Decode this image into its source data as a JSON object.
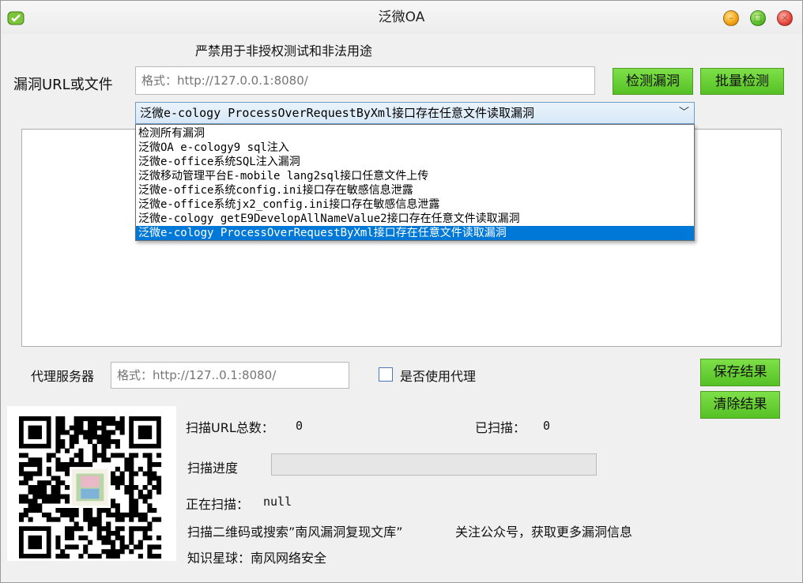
{
  "window": {
    "title": "泛微OA"
  },
  "notice": "严禁用于非授权测试和非法用途",
  "url_section": {
    "label": "漏洞URL或文件",
    "placeholder": "格式：http://127.0.0.1:8080/",
    "detect_button": "检测漏洞",
    "batch_button": "批量检测"
  },
  "vuln_select": {
    "selected": "泛微e-cology ProcessOverRequestByXml接口存在任意文件读取漏洞",
    "options": [
      "检测所有漏洞",
      "泛微OA e-cology9 sql注入",
      "泛微e-office系统SQL注入漏洞",
      "泛微移动管理平台E-mobile lang2sql接口任意文件上传",
      "泛微e-office系统config.ini接口存在敏感信息泄露",
      "泛微e-office系统jx2_config.ini接口存在敏感信息泄露",
      "泛微e-cology getE9DevelopAllNameValue2接口存在任意文件读取漏洞",
      "泛微e-cology ProcessOverRequestByXml接口存在任意文件读取漏洞"
    ]
  },
  "proxy": {
    "label": "代理服务器",
    "placeholder": "格式：http://127..0.1:8080/",
    "use_proxy_label": "是否使用代理"
  },
  "actions": {
    "save": "保存结果",
    "clear": "清除结果"
  },
  "stats": {
    "total_label": "扫描URL总数：",
    "total_value": "0",
    "scanned_label": "已扫描：",
    "scanned_value": "0",
    "progress_label": "扫描进度",
    "progress_percent": 0,
    "current_label": "正在扫描：",
    "current_value": "null"
  },
  "promo": {
    "line1": "扫描二维码或搜索”南风漏洞复现文库”",
    "line1_right": "关注公众号，获取更多漏洞信息",
    "line2": "知识星球：南风网络安全"
  },
  "colors": {
    "button_green": "#55c125",
    "selection_blue": "#0078d7"
  }
}
